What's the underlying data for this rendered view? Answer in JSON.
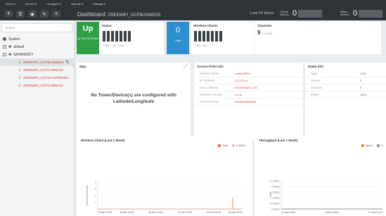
{
  "topbar": {
    "items": [
      "Home ▾",
      "Monitor ▾",
      "Configure ▾",
      "Operate ▾",
      "Manage ▾"
    ]
  },
  "left_toolbar": {
    "buttons": [
      "II",
      "☰",
      "◉",
      "✎",
      "≡"
    ]
  },
  "sidebar": {
    "search_placeholder": "Search",
    "items": [
      {
        "label": "System"
      },
      {
        "label": "default"
      },
      {
        "label": "GRANDACY"
      },
      {
        "label": "ZREEWIFI_GCFBUSINESS"
      },
      {
        "label": "ZREEWIFI_GCFCABINAS2"
      },
      {
        "label": "ZREEWIFI_GCFSALAPRENSA"
      },
      {
        "label": "ZREEWIFI_GCFCABINAS1"
      }
    ]
  },
  "header": {
    "title": "Dashboard:",
    "ssid": "ZREEWIFI_GCFBUSINESS",
    "timerange": "Last 24 hours",
    "critical_label": "Critical Alarms",
    "critical_count": "0",
    "major_label": "Major Alarms",
    "major_count": "0"
  },
  "tiles": {
    "up": {
      "title": "Up",
      "sub": "Up Time 00:45:28m"
    },
    "status": {
      "title": "Status",
      "sub": "Offline: Last 7 days"
    },
    "total": {
      "value": "0",
      "label": "Total"
    },
    "wireless_clients": {
      "title": "Wireless Clients",
      "sub": "Last 7 days"
    },
    "channels": {
      "title": "Channels",
      "value": "9",
      "unit": "2.4 GHz"
    }
  },
  "map": {
    "title": "Map",
    "message": "No Tower/Device(s) are configured with Latitude/Longitude"
  },
  "ap_info": {
    "title": "Access Point Info",
    "rows": [
      {
        "k": "Product Name",
        "v": "cnPilot-R200"
      },
      {
        "k": "IP Address",
        "v": "172.17.0.6"
      },
      {
        "k": "MAC Address",
        "v": "00:04:56:8A:C1:39"
      },
      {
        "k": "Software Version",
        "v": "4.2.5L"
      },
      {
        "k": "Serial Number",
        "v": "A003RDS8DNJW"
      }
    ]
  },
  "radio_info": {
    "title": "Radio Info",
    "rows": [
      {
        "k": "Type",
        "v": "2.4G"
      },
      {
        "k": "Clients",
        "v": "0"
      },
      {
        "k": "Channel",
        "v": "9"
      },
      {
        "k": "Power",
        "v": "100%"
      }
    ]
  },
  "chart_data": [
    {
      "type": "line",
      "title": "Wireless Client (Last 1 Week)",
      "ylabel": "Connected Clients",
      "ylim": [
        0,
        4
      ],
      "yticks": [
        "4",
        "3",
        "2",
        "1"
      ],
      "xticks": [
        "13 Nov 19:30",
        "15 Nov 16:00",
        "16 Nov 19:53",
        "17 Nov 23:43",
        "19 Nov 03:26",
        "20 Nov 19:30"
      ],
      "series": [
        {
          "name": "Total",
          "color": "#e74c3c",
          "values": [
            0,
            0,
            0,
            0,
            0,
            0
          ]
        },
        {
          "name": "2.4GHz",
          "color": "#f4b7b7",
          "values": [
            0,
            0,
            0,
            0,
            0,
            0
          ]
        }
      ]
    },
    {
      "type": "line",
      "title": "Throughput (Last 1 Week)",
      "ylabel": "Rate",
      "yticks": [
        "2.2 Mbps",
        "2 Mbps",
        "1.5 Mbps",
        "1 Mbps",
        "0.5 Mbps",
        "0 Mbps"
      ],
      "xticks": [
        "13 Nov 19:30",
        "15 Nov 16:00",
        "17 Nov 23:43"
      ],
      "series": [
        {
          "name": "Uplink",
          "color": "#e67e22",
          "values": [
            0,
            0,
            0
          ]
        },
        {
          "name": "D",
          "color": "#7f8c8d",
          "values": [
            0,
            0,
            0
          ]
        }
      ]
    }
  ]
}
